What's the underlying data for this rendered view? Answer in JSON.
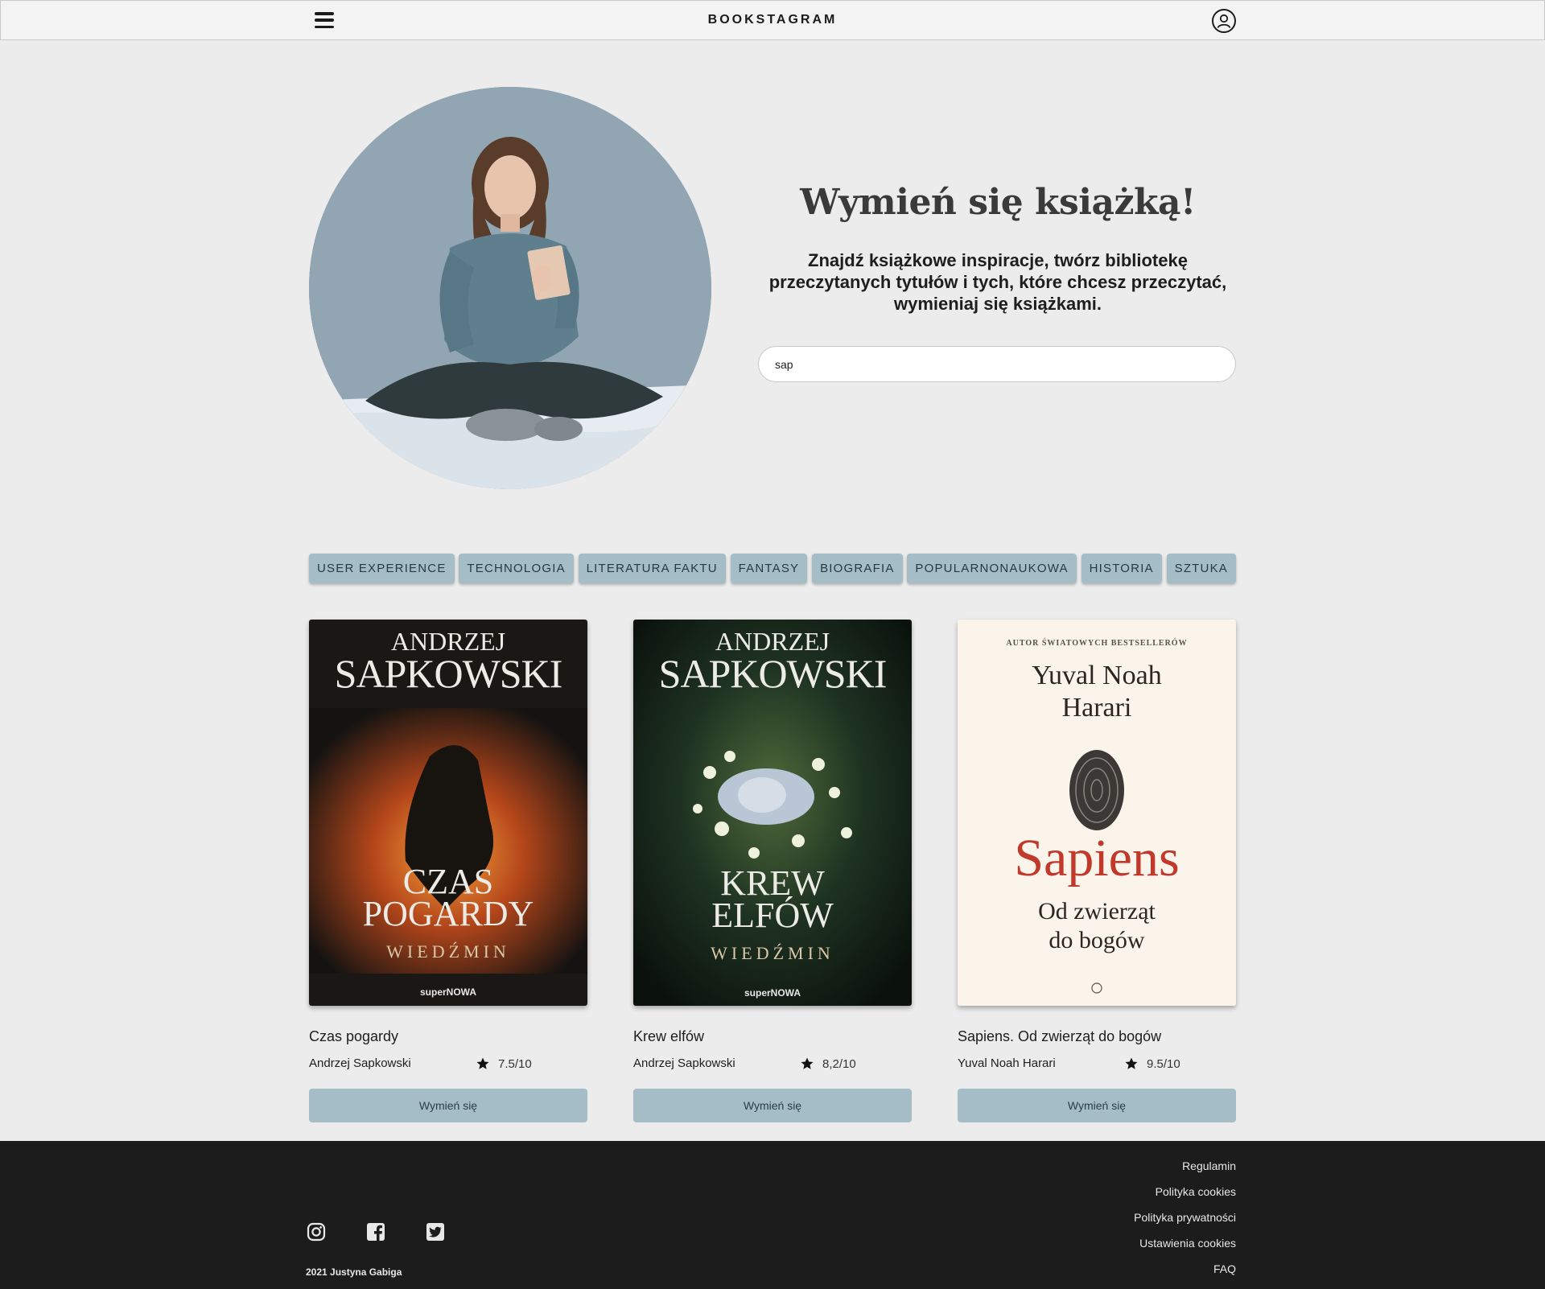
{
  "header": {
    "brand": "BOOKSTAGRAM",
    "menu_icon": "hamburger-menu-icon",
    "account_icon": "user-account-icon"
  },
  "hero": {
    "title": "Wymień się książką!",
    "subtitle": "Znajdź książkowe inspiracje, twórz bibliotekę przeczytanych tytułów i tych, które chcesz przeczytać, wymieniaj się książkami.",
    "search": {
      "value": "sap",
      "placeholder": ""
    }
  },
  "categories": [
    "USER EXPERIENCE",
    "TECHNOLOGIA",
    "LITERATURA FAKTU",
    "FANTASY",
    "BIOGRAFIA",
    "POPULARNONAUKOWA",
    "HISTORIA",
    "SZTUKA"
  ],
  "books": [
    {
      "title": "Czas pogardy",
      "author": "Andrzej Sapkowski",
      "rating": "7.5/10",
      "button": "Wymień się",
      "cover": {
        "top_line": "ANDRZEJ",
        "author_line": "SAPKOWSKI",
        "title_lines": [
          "CZAS",
          "POGARDY"
        ],
        "series": "WIEDŹMIN",
        "publisher": "superNOWA"
      }
    },
    {
      "title": "Krew elfów",
      "author": "Andrzej Sapkowski",
      "rating": "8,2/10",
      "button": "Wymień się",
      "cover": {
        "top_line": "ANDRZEJ",
        "author_line": "SAPKOWSKI",
        "title_lines": [
          "KREW",
          "ELFÓW"
        ],
        "series": "WIEDŹMIN",
        "publisher": "superNOWA"
      }
    },
    {
      "title": "Sapiens. Od zwierząt do bogów",
      "author": "Yuval Noah Harari",
      "rating": "9.5/10",
      "button": "Wymień się",
      "cover": {
        "top_line": "AUTOR ŚWIATOWYCH BESTSELLERÓW",
        "author_lines": [
          "Yuval Noah",
          "Harari"
        ],
        "title_line": "Sapiens",
        "subtitle_lines": [
          "Od zwierząt",
          "do bogów"
        ]
      }
    }
  ],
  "footer": {
    "copyright": "2021 Justyna Gabiga",
    "social_icons": [
      "instagram-icon",
      "facebook-icon",
      "twitter-icon"
    ],
    "links": [
      "Regulamin",
      "Polityka cookies",
      "Polityka prywatności",
      "Ustawienia cookies",
      "FAQ"
    ]
  },
  "colors": {
    "page_background": "#ececec",
    "accent": "#a4bdc6",
    "footer_background": "#1c1c1c",
    "sapiens_title_red": "#c0392b"
  }
}
